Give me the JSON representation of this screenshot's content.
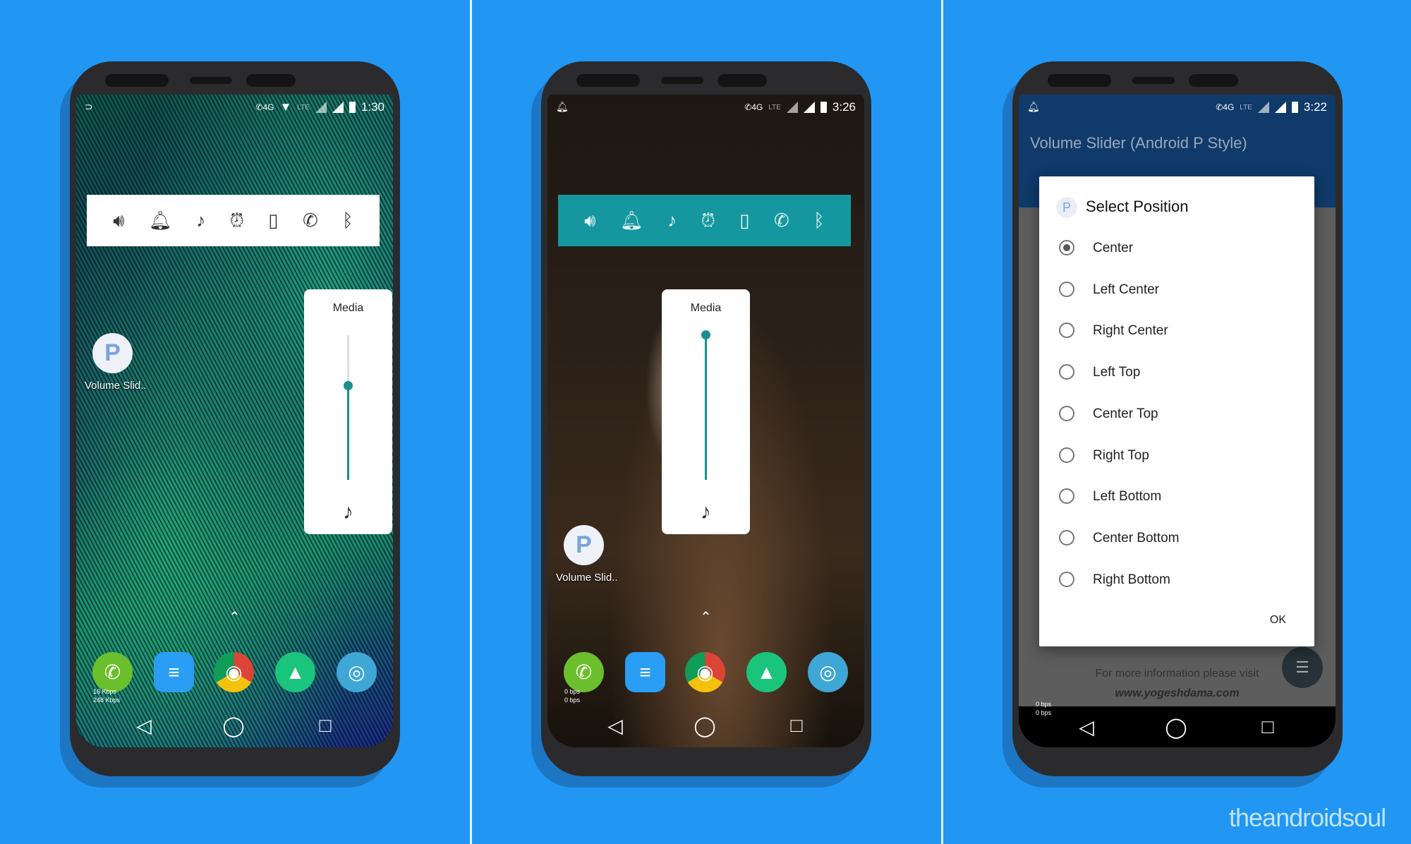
{
  "colors": {
    "background": "#2196f3",
    "accent": "#1a8f8c",
    "iconbar_teal": "#15979f",
    "appbar": "#0f3a6a"
  },
  "panels": [
    {
      "status": {
        "left_icon": "cast-icon",
        "time": "1:30",
        "icons": [
          "call-4g-icon",
          "wifi-icon",
          "lte-icon",
          "signal-icon",
          "signal-icon",
          "battery-icon"
        ]
      },
      "icon_bar": {
        "style": "white",
        "icons": [
          "speaker-icon",
          "bell-icon",
          "music-note-icon",
          "alarm-icon",
          "phone-device-icon",
          "call-icon",
          "bluetooth-icon"
        ]
      },
      "media_panel": {
        "title": "Media",
        "level_percent": 65
      },
      "app": {
        "label": "Volume Slid.."
      },
      "bps": {
        "up": "16 Kbps",
        "down": "248 Kbps"
      }
    },
    {
      "status": {
        "left_icon": "bell-icon",
        "time": "3:26",
        "icons": [
          "call-4g-icon",
          "lte-icon",
          "signal-icon",
          "signal-icon",
          "battery-icon"
        ]
      },
      "icon_bar": {
        "style": "teal",
        "icons": [
          "speaker-icon",
          "bell-icon",
          "music-note-icon",
          "alarm-icon",
          "phone-device-icon",
          "call-icon",
          "bluetooth-icon"
        ]
      },
      "media_panel": {
        "title": "Media",
        "level_percent": 100
      },
      "app": {
        "label": "Volume Slid.."
      },
      "bps": {
        "up": "0 bps",
        "down": "0 bps"
      }
    },
    {
      "status": {
        "left_icon": "bell-icon",
        "time": "3:22",
        "icons": [
          "call-4g-icon",
          "lte-icon",
          "signal-icon",
          "signal-icon",
          "battery-icon"
        ]
      },
      "app_title": "Volume Slider (Android P Style)",
      "dialog": {
        "title": "Select Position",
        "selected": "Center",
        "options": [
          "Center",
          "Left Center",
          "Right Center",
          "Left Top",
          "Center Top",
          "Right Top",
          "Left Bottom",
          "Center Bottom",
          "Right Bottom"
        ],
        "ok_label": "OK"
      },
      "footer": {
        "text": "For more information please visit",
        "url": "www.yogeshdama.com"
      },
      "bps": {
        "up": "0 bps",
        "down": "0 bps"
      }
    }
  ],
  "dock_icons": [
    "phone-app-icon",
    "messages-icon",
    "chrome-icon",
    "gallery-icon",
    "camera-icon"
  ],
  "nav": [
    "back-icon",
    "home-icon",
    "recents-icon"
  ],
  "watermark": "theandroidsoul"
}
